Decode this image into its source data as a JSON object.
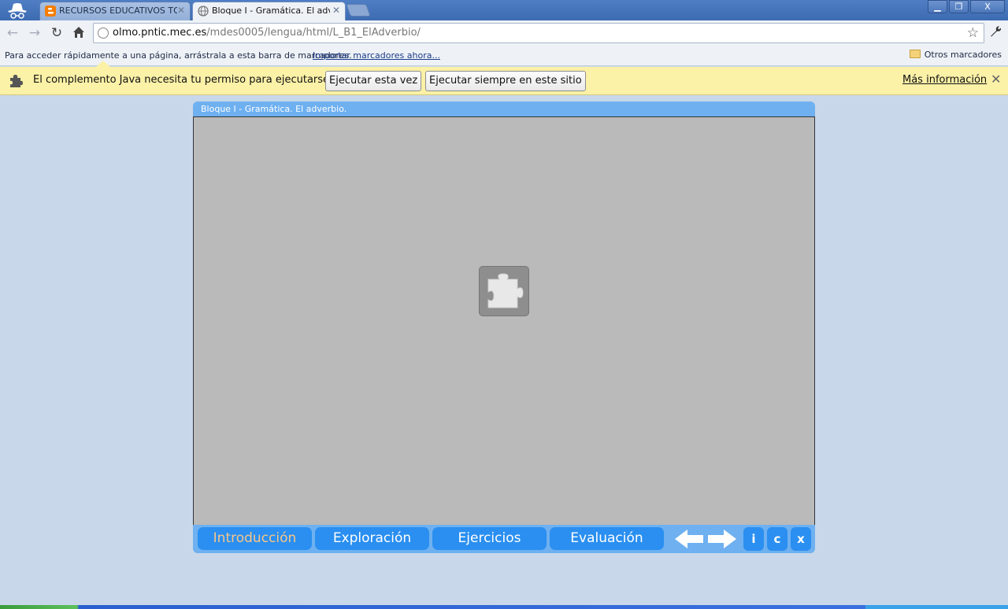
{
  "browser": {
    "tabs": [
      {
        "title": "RECURSOS EDUCATIVOS TOM",
        "active": false,
        "favicon": "blogger-icon"
      },
      {
        "title": "Bloque I  -  Gramática. El adve",
        "active": true,
        "favicon": "globe-icon"
      }
    ],
    "window_buttons": {
      "minimize": "▁",
      "maximize": "❐",
      "close": "X"
    },
    "url_host": "olmo.pntic.mec.es",
    "url_path": "/mdes0005/lengua/html/L_B1_ElAdverbio/"
  },
  "bookmarks_bar": {
    "hint": "Para acceder rápidamente a una página, arrástrala a esta barra de marcadores.",
    "import_link": "Importar marcadores ahora...",
    "other": "Otros marcadores"
  },
  "infobar": {
    "message": "El complemento Java necesita tu permiso para ejecutarse.",
    "run_once": "Ejecutar esta vez",
    "run_always": "Ejecutar siempre en este sitio",
    "more_info": "Más información",
    "close": "✕"
  },
  "page": {
    "header_title": "Bloque I  -  Gramática. El adverbio.",
    "nav_tabs": [
      {
        "label": "Introducción",
        "active": true
      },
      {
        "label": "Exploración",
        "active": false
      },
      {
        "label": "Ejercicios",
        "active": false
      },
      {
        "label": "Evaluación",
        "active": false
      }
    ],
    "buttons": {
      "info": "i",
      "credits": "c",
      "exit": "x"
    }
  },
  "colors": {
    "accent_blue": "#2a8ff0",
    "panel_blue": "#6eb0f0",
    "active_tab_text": "#f6c58a",
    "infobar_bg": "#fbf1a7",
    "page_bg": "#c8d8ea"
  }
}
